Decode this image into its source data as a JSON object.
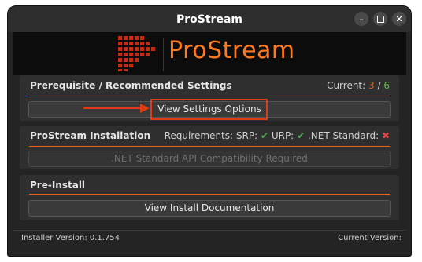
{
  "window": {
    "title": "ProStream"
  },
  "logo": {
    "text": "ProStream"
  },
  "prereq": {
    "title": "Prerequisite / Recommended Settings",
    "current_label": "Current:",
    "current_value": "3",
    "current_sep": "/",
    "current_total": "6",
    "button_label": "View Settings Options"
  },
  "install": {
    "title": "ProStream Installation",
    "requirements_label": "Requirements:",
    "srp_label": "SRP:",
    "srp_status": "✔",
    "urp_label": "URP:",
    "urp_status": "✔",
    "net_label": ".NET Standard:",
    "net_status": "✖",
    "button_label": ".NET Standard API Compatibility Required"
  },
  "preinstall": {
    "title": "Pre-Install",
    "button_label": "View Install Documentation"
  },
  "footer": {
    "installer_version": "Installer Version: 0.1.754",
    "current_version": "Current Version:"
  },
  "colors": {
    "accent": "#e8621c",
    "annotation": "#e03a17",
    "ok": "#4caf50",
    "error": "#e04848"
  }
}
